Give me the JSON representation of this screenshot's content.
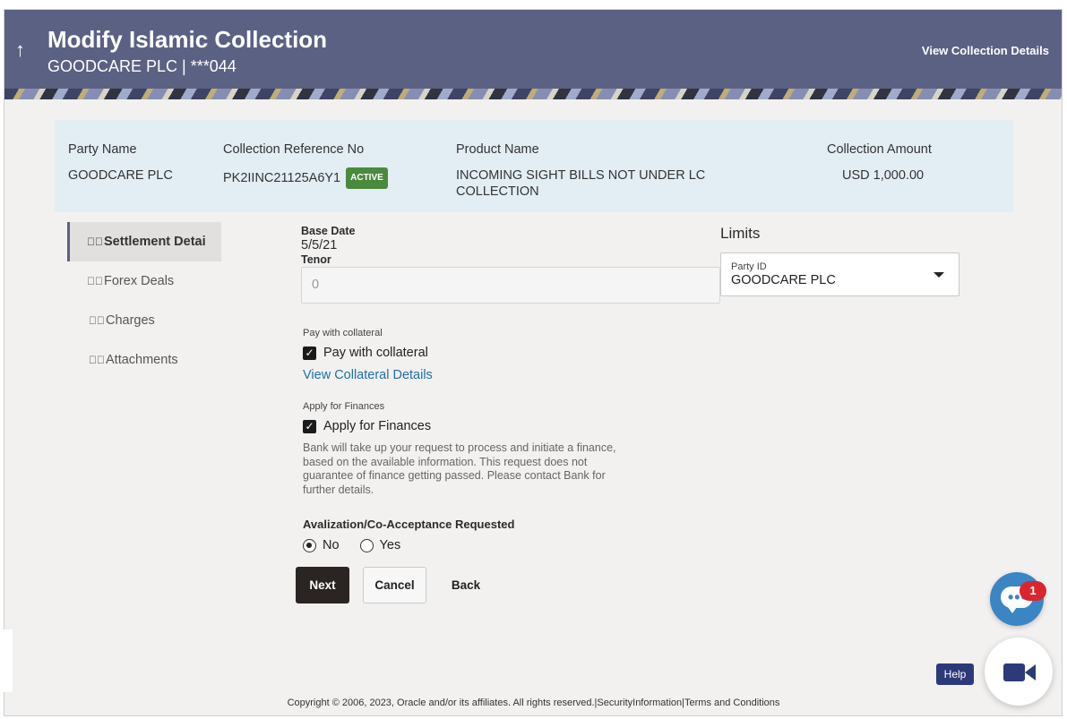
{
  "header": {
    "title": "Modify Islamic Collection",
    "subtitle": "GOODCARE PLC | ***044",
    "view_details_link": "View Collection Details",
    "back_icon": "up-arrow-icon",
    "colors": {
      "header_bg": "#5b6182"
    }
  },
  "summary": {
    "party_name_label": "Party Name",
    "party_name_value": "GOODCARE PLC",
    "reference_label": "Collection Reference No",
    "reference_value": "PK2IINC21125A6Y1",
    "status_badge": "ACTIVE",
    "product_label": "Product Name",
    "product_value": "INCOMING SIGHT BILLS NOT UNDER LC COLLECTION",
    "amount_label": "Collection Amount",
    "amount_value": "USD 1,000.00"
  },
  "sidebar": {
    "items": [
      {
        "label": "Settlement Detai",
        "active": true
      },
      {
        "label": "Forex Deals",
        "active": false
      },
      {
        "label": "Charges",
        "active": false
      },
      {
        "label": "Attachments",
        "active": false
      }
    ]
  },
  "form": {
    "base_date_label": "Base Date",
    "base_date_value": "5/5/21",
    "tenor_label": "Tenor",
    "tenor_value": "0",
    "pay_collateral_section_label": "Pay with collateral",
    "pay_collateral_checkbox_label": "Pay with collateral",
    "pay_collateral_checked": true,
    "view_collateral_link": "View Collateral Details",
    "apply_finances_section_label": "Apply for Finances",
    "apply_finances_checkbox_label": "Apply for Finances",
    "apply_finances_checked": true,
    "finance_note": "Bank will take up your request to process and initiate a finance, based on the available information. This request does not guarantee of finance getting passed. Please contact Bank for further details.",
    "avalization_label": "Avalization/Co-Acceptance Requested",
    "radio_no_label": "No",
    "radio_yes_label": "Yes",
    "radio_selected": "No"
  },
  "limits": {
    "title": "Limits",
    "party_id_label": "Party ID",
    "party_id_value": "GOODCARE PLC"
  },
  "actions": {
    "next_label": "Next",
    "cancel_label": "Cancel",
    "back_label": "Back"
  },
  "widgets": {
    "chat_badge_count": "1",
    "help_label": "Help",
    "chat_icon": "chat-bubble-icon",
    "video_icon": "video-camera-icon"
  },
  "footer": {
    "copyright": "Copyright © 2006, 2023, Oracle and/or its affiliates. All rights reserved.|SecurityInformation|Terms and Conditions"
  }
}
